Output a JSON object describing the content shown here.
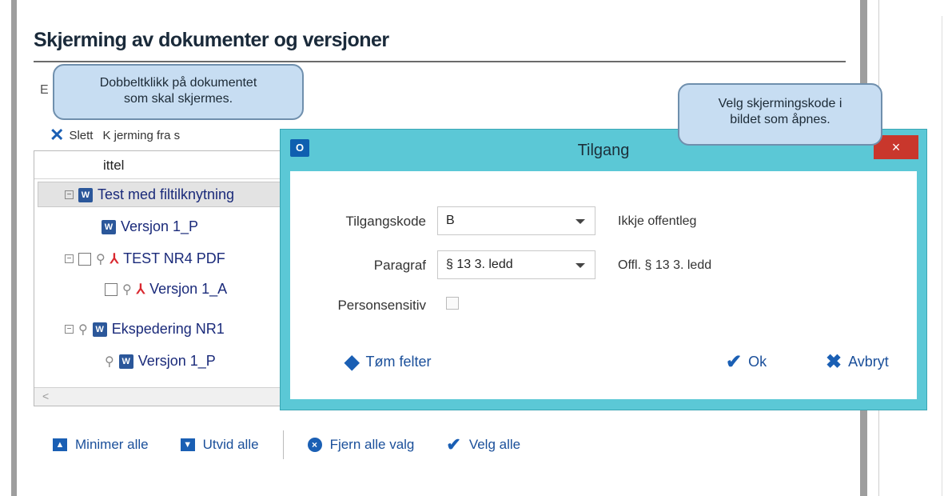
{
  "page": {
    "title": "Skjerming av dokumenter og versjoner",
    "hidden_label": "E",
    "toolbar": {
      "delete_label": "Slett",
      "partial_text": "K        jerming fra s"
    }
  },
  "tree": {
    "column_header": "ittel",
    "rows": [
      {
        "label": "Test med filtilknytning",
        "kind": "word"
      },
      {
        "label": "Versjon 1_P",
        "kind": "word"
      },
      {
        "label": "TEST NR4 PDF",
        "kind": "pdf"
      },
      {
        "label": "Versjon 1_A",
        "kind": "pdf"
      },
      {
        "label": "Ekspedering NR1",
        "kind": "word"
      },
      {
        "label": "Versjon 1_P",
        "kind": "word"
      }
    ],
    "scroll_arrow": "<"
  },
  "bottom_bar": {
    "minimize_all": "Minimer alle",
    "expand_all": "Utvid alle",
    "clear_all": "Fjern alle valg",
    "select_all": "Velg alle"
  },
  "dialog": {
    "title": "Tilgang",
    "close": "×",
    "app_icon": "O",
    "access_code_label": "Tilgangskode",
    "access_code_value": "B",
    "access_code_desc": "Ikkje offentleg",
    "paragraph_label": "Paragraf",
    "paragraph_value": "§ 13 3. ledd",
    "paragraph_desc": "Offl. § 13 3. ledd",
    "personsensitive_label": "Personsensitiv",
    "personsensitive_checked": false,
    "clear_fields": "Tøm felter",
    "ok": "Ok",
    "cancel": "Avbryt"
  },
  "callouts": {
    "left_line1": "Dobbeltklikk på dokumentet",
    "left_line2": "som skal skjermes.",
    "right_line1": "Velg skjermingskode i",
    "right_line2": "bildet som åpnes."
  },
  "colors": {
    "dialog_frame": "#5bc8d6",
    "close_button": "#c9372c",
    "accent_blue": "#1a5fb4",
    "callout_fill": "#c7ddf2"
  }
}
